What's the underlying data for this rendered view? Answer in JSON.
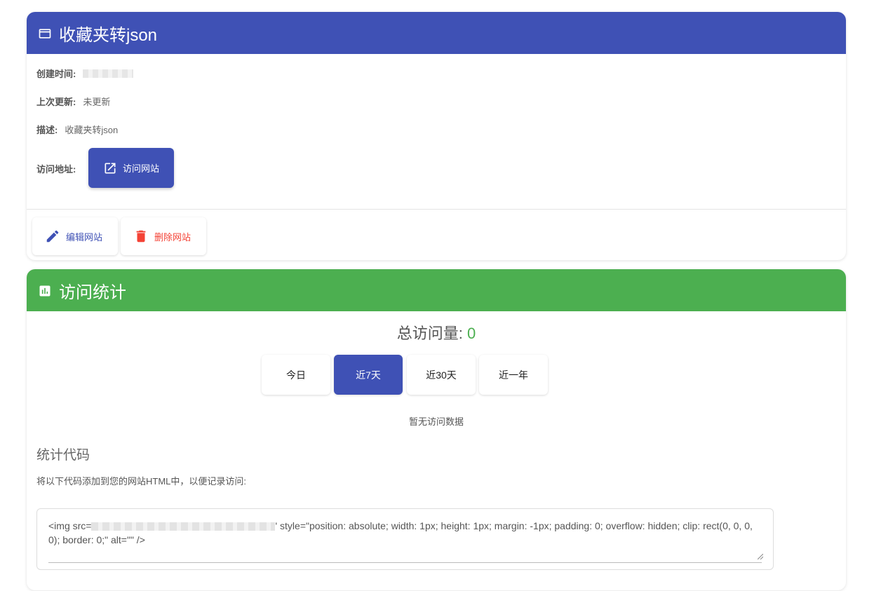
{
  "site_card": {
    "title": "收藏夹转json",
    "created_label": "创建时间:",
    "updated_label": "上次更新:",
    "updated_value": "未更新",
    "desc_label": "描述:",
    "desc_value": "收藏夹转json",
    "url_label": "访问地址:",
    "visit_button": "访问网站",
    "edit_button": "编辑网站",
    "delete_button": "删除网站",
    "icons": {
      "header": "web-window-icon",
      "visit": "open-in-new-icon",
      "edit": "pencil-icon",
      "delete": "trash-icon"
    },
    "colors": {
      "header": "#3f51b5",
      "delete": "#f44336"
    }
  },
  "stats_card": {
    "title": "访问统计",
    "total_label": "总访问量: ",
    "total_value": "0",
    "ranges": [
      "今日",
      "近7天",
      "近30天",
      "近一年"
    ],
    "active_range": "近7天",
    "no_data": "暂无访问数据",
    "code_title": "统计代码",
    "code_desc": "将以下代码添加到您的网站HTML中，以便记录访问:",
    "code_prefix": "<img src=",
    "code_suffix": "' style=\"position: absolute; width: 1px; height: 1px; margin: -1px; padding: 0; overflow: hidden; clip: rect(0, 0, 0, 0); border: 0;\" alt=\"\" />",
    "icons": {
      "header": "bar-chart-icon"
    },
    "colors": {
      "header": "#4caf50",
      "total": "#4caf50"
    }
  }
}
